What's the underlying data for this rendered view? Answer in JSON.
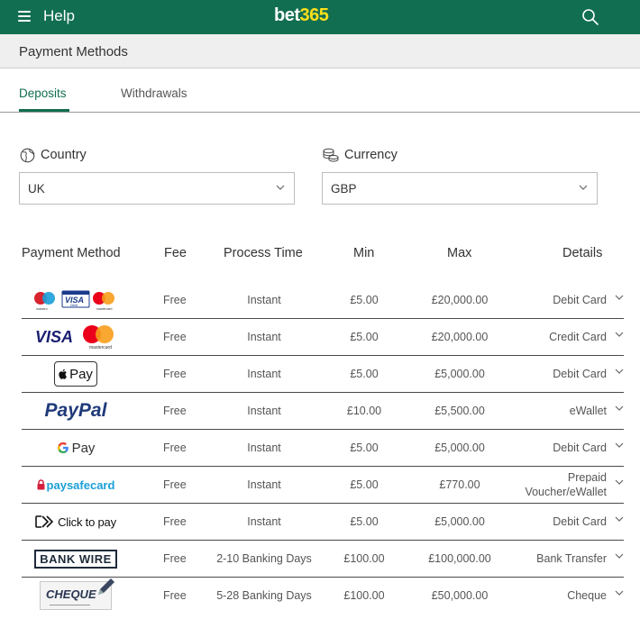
{
  "header": {
    "help_label": "Help",
    "logo_part1": "bet",
    "logo_part2": "365",
    "brand_color": "#126e51",
    "logo_accent": "#ffdf1b"
  },
  "subheader": {
    "title": "Payment Methods"
  },
  "tabs": [
    {
      "label": "Deposits",
      "active": true
    },
    {
      "label": "Withdrawals",
      "active": false
    }
  ],
  "filters": {
    "country": {
      "label": "Country",
      "value": "UK",
      "icon": "globe-icon"
    },
    "currency": {
      "label": "Currency",
      "value": "GBP",
      "icon": "coins-icon"
    }
  },
  "table": {
    "columns": [
      "Payment Method",
      "Fee",
      "Process Time",
      "Min",
      "Max",
      "Details"
    ],
    "rows": [
      {
        "logo": "maestro-visa-debit-mastercard-logo",
        "fee": "Free",
        "time": "Instant",
        "min": "£5.00",
        "max": "£20,000.00",
        "details": "Debit Card"
      },
      {
        "logo": "visa-mastercard-logo",
        "fee": "Free",
        "time": "Instant",
        "min": "£5.00",
        "max": "£20,000.00",
        "details": "Credit Card"
      },
      {
        "logo": "apple-pay-logo",
        "logo_text": "Pay",
        "fee": "Free",
        "time": "Instant",
        "min": "£5.00",
        "max": "£5,000.00",
        "details": "Debit Card"
      },
      {
        "logo": "paypal-logo",
        "logo_text": "PayPal",
        "fee": "Free",
        "time": "Instant",
        "min": "£10.00",
        "max": "£5,500.00",
        "details": "eWallet"
      },
      {
        "logo": "google-pay-logo",
        "logo_text": "Pay",
        "fee": "Free",
        "time": "Instant",
        "min": "£5.00",
        "max": "£5,000.00",
        "details": "Debit Card"
      },
      {
        "logo": "paysafecard-logo",
        "logo_text": "paysafecard",
        "fee": "Free",
        "time": "Instant",
        "min": "£5.00",
        "max": "£770.00",
        "details_line1": "Prepaid",
        "details_line2": "Voucher/eWallet"
      },
      {
        "logo": "click-to-pay-logo",
        "logo_text": "Click to pay",
        "fee": "Free",
        "time": "Instant",
        "min": "£5.00",
        "max": "£5,000.00",
        "details": "Debit Card"
      },
      {
        "logo": "bank-wire-logo",
        "logo_text": "BANK WIRE",
        "fee": "Free",
        "time": "2-10 Banking Days",
        "min": "£100.00",
        "max": "£100,000.00",
        "details": "Bank Transfer"
      },
      {
        "logo": "cheque-logo",
        "logo_text": "CHEQUE",
        "fee": "Free",
        "time": "5-28 Banking Days",
        "min": "£100.00",
        "max": "£50,000.00",
        "details": "Cheque"
      }
    ]
  }
}
